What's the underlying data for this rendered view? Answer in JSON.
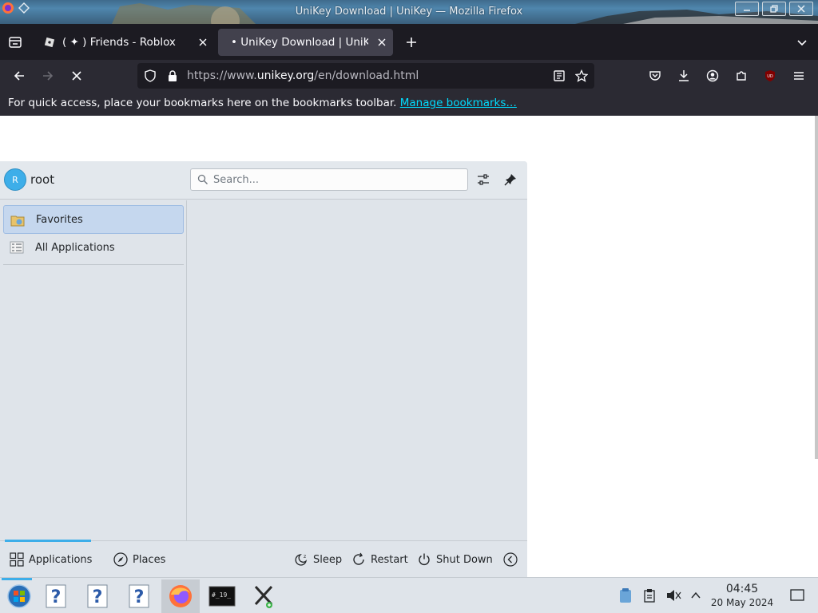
{
  "window": {
    "title": "UniKey Download | UniKey — Mozilla Firefox"
  },
  "tabs": [
    {
      "label": "( ✦ ) Friends - Roblox",
      "active": false
    },
    {
      "label": "• UniKey Download | UniKe",
      "active": true
    }
  ],
  "navbar": {
    "url_prefix": "https://www.",
    "url_domain": "unikey.org",
    "url_path": "/en/download.html"
  },
  "bookmarks_bar": {
    "message": "For quick access, place your bookmarks here on the bookmarks toolbar.",
    "link": "Manage bookmarks…"
  },
  "kmenu": {
    "user_initial": "R",
    "username": "root",
    "search_placeholder": "Search...",
    "categories": [
      {
        "label": "Favorites",
        "selected": true,
        "icon": "favorites-icon"
      },
      {
        "label": "All Applications",
        "selected": false,
        "icon": "all-applications-icon"
      }
    ],
    "footer": {
      "applications": "Applications",
      "places": "Places",
      "sleep": "Sleep",
      "restart": "Restart",
      "shutdown": "Shut Down"
    }
  },
  "taskbar": {
    "time": "04:45",
    "date": "20 May 2024",
    "items": [
      "start-menu-icon",
      "unknown-app-icon",
      "unknown-app-icon",
      "unknown-app-icon",
      "firefox-icon",
      "terminal-icon",
      "x-app-icon"
    ]
  },
  "colors": {
    "accent": "#3daee9",
    "link": "#00ddff",
    "tab_active_bg": "#42414d",
    "toolbar_bg": "#2b2a33",
    "menu_bg": "#dfe4ea",
    "selected_bg": "#c5d7ee"
  }
}
